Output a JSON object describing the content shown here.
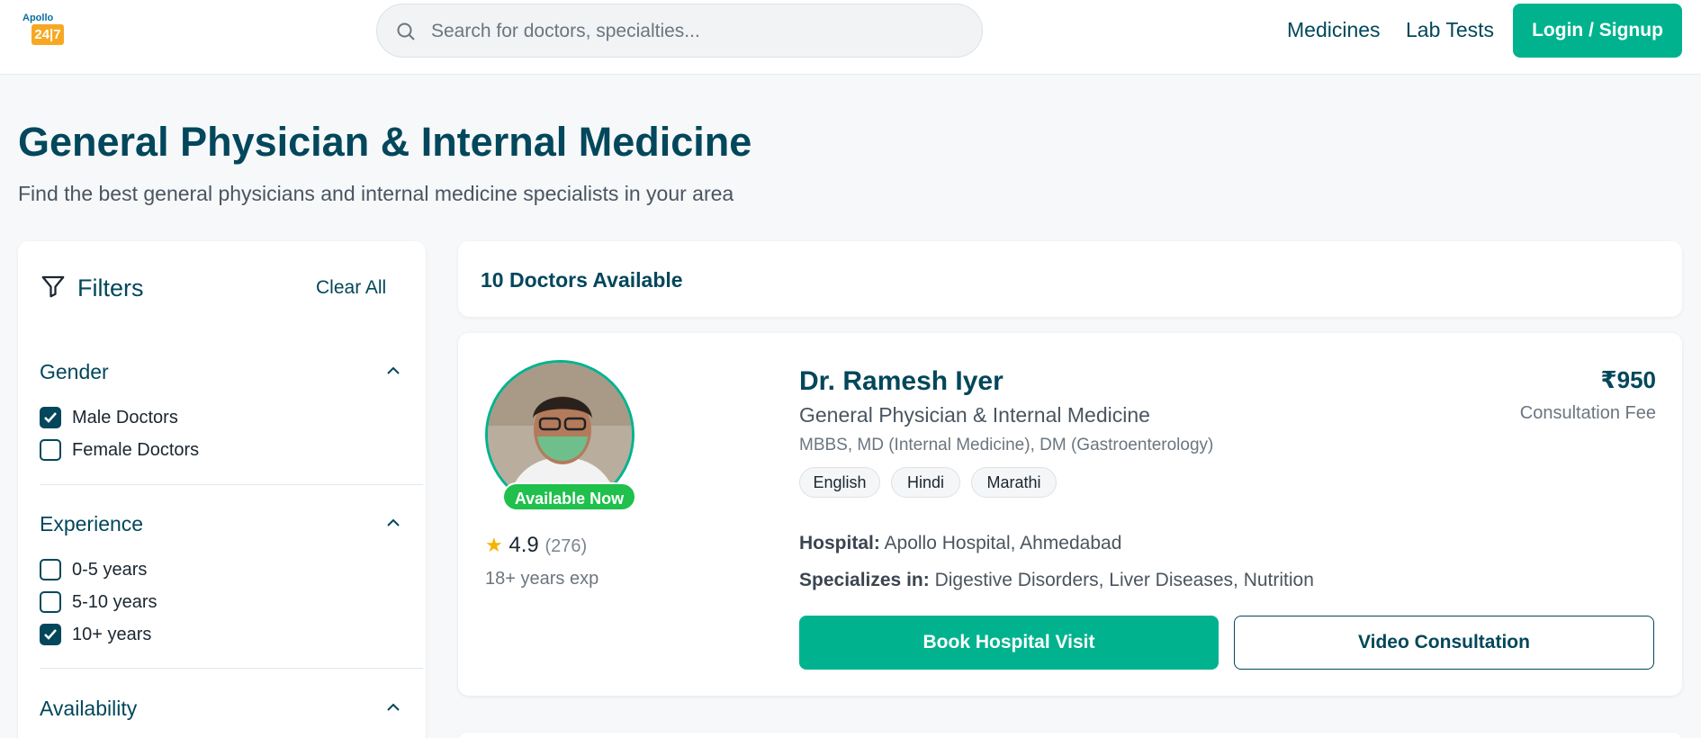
{
  "header": {
    "logo_top": "Apollo",
    "logo_badge": "24|7",
    "search_placeholder": "Search for doctors, specialties...",
    "nav_medicines": "Medicines",
    "nav_lab_tests": "Lab Tests",
    "login_label": "Login / Signup",
    "accent_color": "#00b38e",
    "brand_color": "#02475b"
  },
  "page": {
    "title": "General Physician & Internal Medicine",
    "subtitle": "Find the best general physicians and internal medicine specialists in your area"
  },
  "filters": {
    "title": "Filters",
    "clear_all": "Clear All",
    "sections": [
      {
        "label": "Gender",
        "options": [
          {
            "label": "Male Doctors",
            "checked": true
          },
          {
            "label": "Female Doctors",
            "checked": false
          }
        ]
      },
      {
        "label": "Experience",
        "options": [
          {
            "label": "0-5 years",
            "checked": false
          },
          {
            "label": "5-10 years",
            "checked": false
          },
          {
            "label": "10+ years",
            "checked": true
          }
        ]
      },
      {
        "label": "Availability",
        "options": []
      }
    ]
  },
  "results": {
    "count_label": "10 Doctors Available"
  },
  "doctor": {
    "name": "Dr. Ramesh Iyer",
    "specialty": "General Physician & Internal Medicine",
    "qualifications": "MBBS, MD (Internal Medicine), DM (Gastroenterology)",
    "languages": [
      "English",
      "Hindi",
      "Marathi"
    ],
    "availability_badge": "Available Now",
    "rating": "4.9",
    "reviews": "(276)",
    "experience": "18+ years exp",
    "fee": "₹950",
    "fee_label": "Consultation Fee",
    "hospital_label": "Hospital:",
    "hospital": "Apollo Hospital, Ahmedabad",
    "specializes_label": "Specializes in:",
    "specializes": "Digestive Disorders, Liver Diseases, Nutrition",
    "book_label": "Book Hospital Visit",
    "video_label": "Video Consultation"
  }
}
